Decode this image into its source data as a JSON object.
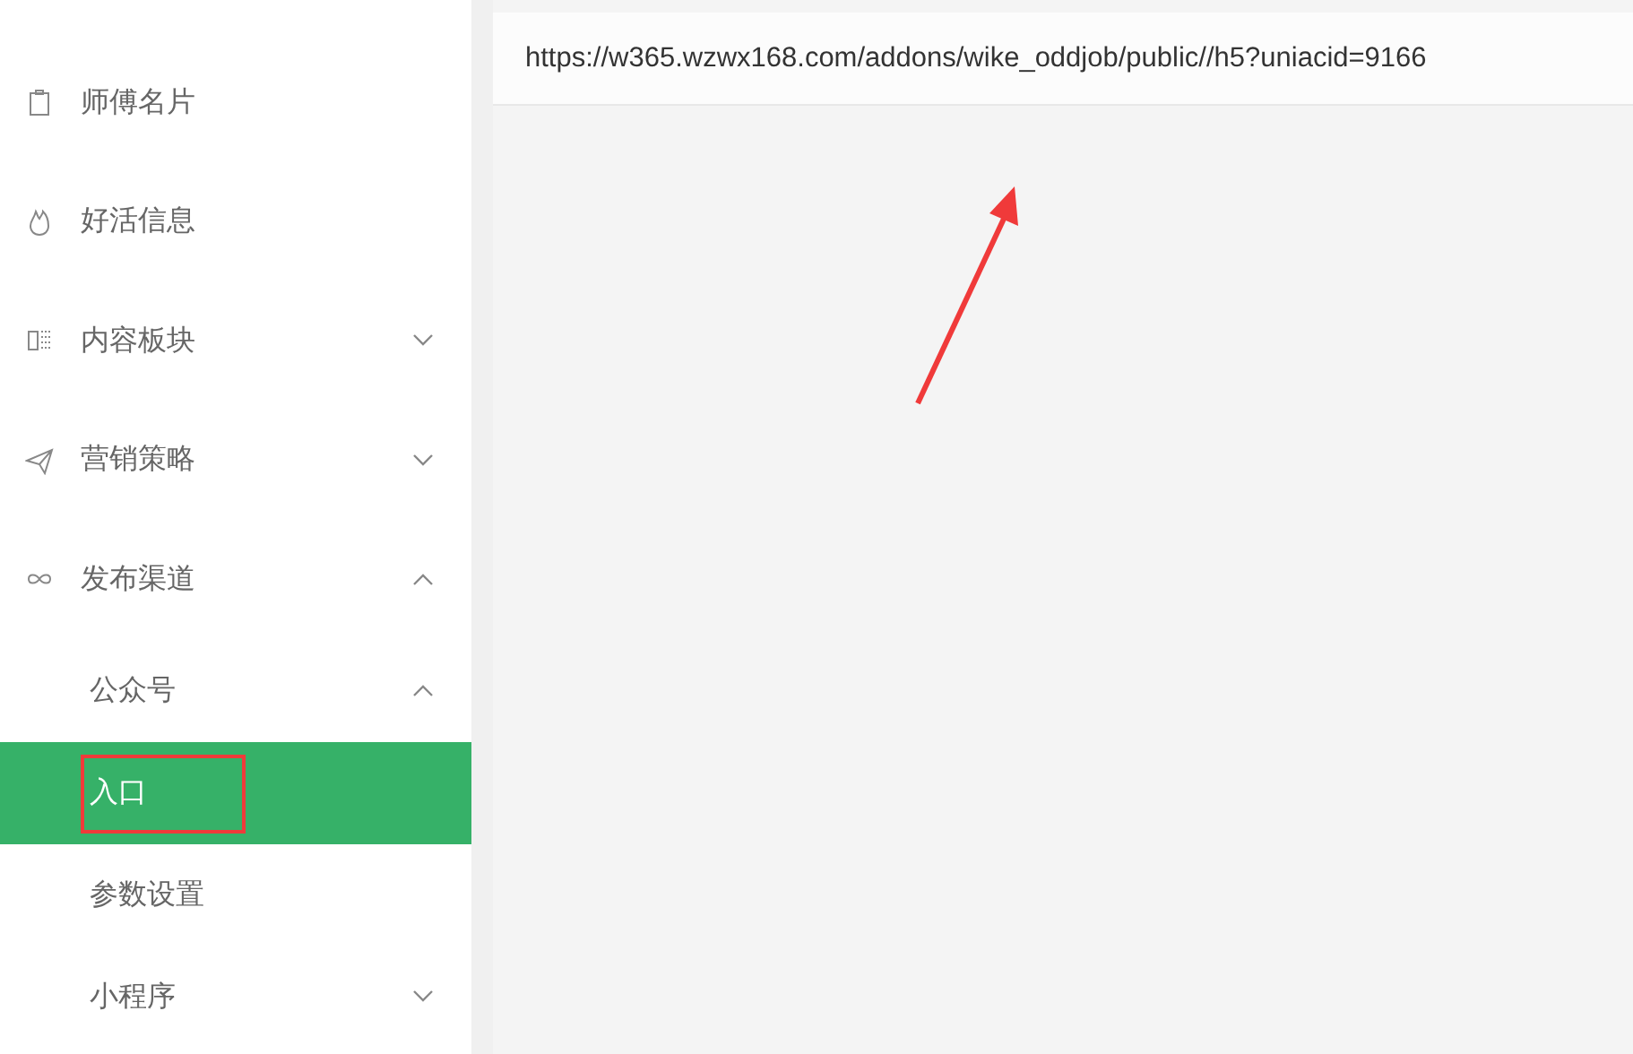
{
  "sidebar": {
    "items": [
      {
        "label": "师傅名片",
        "selected": false
      },
      {
        "label": "好活信息",
        "selected": false
      },
      {
        "label": "内容板块",
        "selected": false,
        "expanded": false
      },
      {
        "label": "营销策略",
        "selected": false,
        "expanded": false
      },
      {
        "label": "发布渠道",
        "selected": false,
        "expanded": true,
        "children": [
          {
            "label": "公众号",
            "selected": false,
            "expanded": true,
            "children": [
              {
                "label": "入口",
                "selected": true
              },
              {
                "label": "参数设置",
                "selected": false
              }
            ]
          },
          {
            "label": "小程序",
            "selected": false,
            "expanded": false
          }
        ]
      }
    ]
  },
  "url_panel": {
    "text": "https://w365.wzwx168.com/addons/wike_oddjob/public//h5?uniacid=9166"
  }
}
